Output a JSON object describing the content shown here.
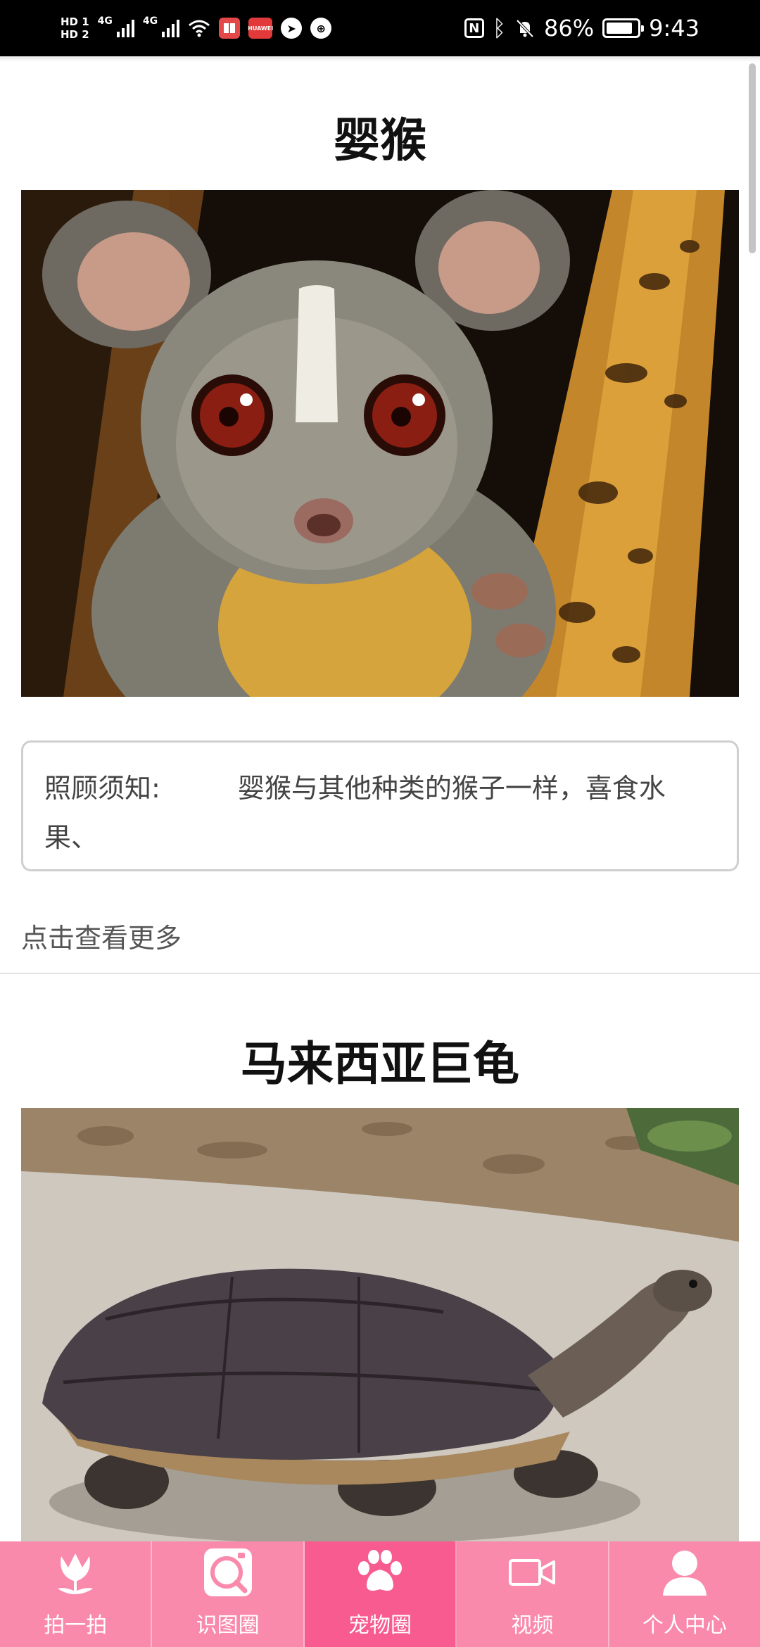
{
  "status_bar": {
    "hd1": "HD 1",
    "hd2": "HD 2",
    "net1": "4G",
    "net2": "4G",
    "battery_text": "86%",
    "battery_level": 0.86,
    "time": "9:43",
    "nfc_label": "N",
    "app2_label": "HUAWEI"
  },
  "cards": [
    {
      "title": "婴猴",
      "photo_icon": "galago-photo",
      "notice_label": "照顾须知:",
      "notice_text": "婴猴与其他种类的猴子一样，喜食水果、",
      "more_label": "点击查看更多"
    },
    {
      "title": "马来西亚巨龟",
      "photo_icon": "turtle-photo"
    }
  ],
  "bottom_nav": {
    "items": [
      {
        "label": "拍一拍",
        "icon": "tulip-icon"
      },
      {
        "label": "识图圈",
        "icon": "image-search-icon"
      },
      {
        "label": "宠物圈",
        "icon": "paw-icon",
        "active": true
      },
      {
        "label": "视频",
        "icon": "video-icon"
      },
      {
        "label": "个人中心",
        "icon": "user-icon"
      }
    ],
    "colors": {
      "background": "#fa8aac",
      "active": "#f75b8f"
    }
  }
}
